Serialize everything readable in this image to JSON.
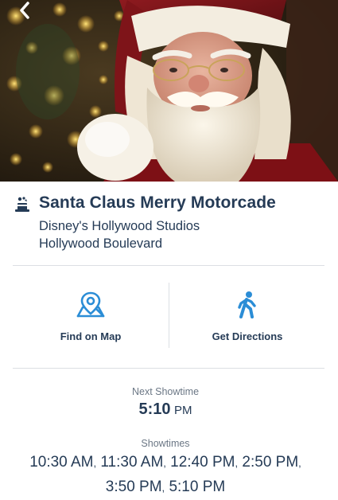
{
  "header": {
    "back_icon": "chevron-left-icon"
  },
  "attraction": {
    "icon": "magic-hat-icon",
    "name": "Santa Claus Merry Motorcade",
    "park": "Disney's Hollywood Studios",
    "area": "Hollywood Boulevard"
  },
  "actions": {
    "map": {
      "label": "Find on Map",
      "icon": "map-pin-icon"
    },
    "directions": {
      "label": "Get Directions",
      "icon": "walking-person-icon"
    }
  },
  "next_showtime": {
    "label": "Next Showtime",
    "time": "5:10",
    "meridiem": "PM"
  },
  "showtimes": {
    "label": "Showtimes",
    "times": [
      {
        "time": "10:30",
        "meridiem": "AM"
      },
      {
        "time": "11:30",
        "meridiem": "AM"
      },
      {
        "time": "12:40",
        "meridiem": "PM"
      },
      {
        "time": "2:50",
        "meridiem": "PM"
      },
      {
        "time": "3:50",
        "meridiem": "PM"
      },
      {
        "time": "5:10",
        "meridiem": "PM"
      }
    ]
  },
  "colors": {
    "text": "#253b56",
    "muted": "#6b7785",
    "accent": "#2b8dd6",
    "divider": "#dcdfe3"
  }
}
